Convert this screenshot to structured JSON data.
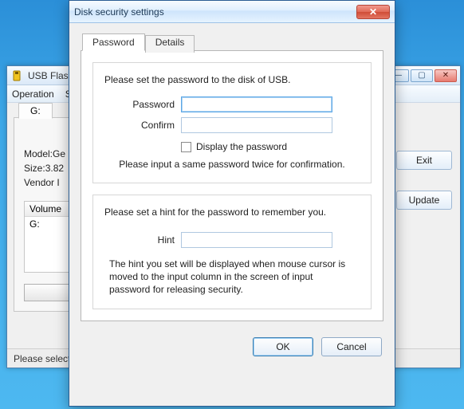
{
  "back_window": {
    "title": "USB Flash S",
    "menu": {
      "operation": "Operation",
      "second": "S"
    },
    "drive_tab": "G:",
    "info": {
      "model_label": "Model:",
      "model_value": "Ge",
      "size_label": "Size:",
      "size_value": "3.82",
      "vendor_label": "Vendor I"
    },
    "list": {
      "header": "Volume",
      "row": "G:"
    },
    "status": "Please select a ",
    "exit": "Exit",
    "update": "Update"
  },
  "dialog": {
    "title": "Disk security settings",
    "tabs": {
      "password": "Password",
      "details": "Details"
    },
    "pw_group": {
      "heading": "Please set the password to the disk of USB.",
      "password_label": "Password",
      "confirm_label": "Confirm",
      "display_checkbox": "Display the password",
      "note": "Please input a same password twice for confirmation.",
      "password_value": "",
      "confirm_value": ""
    },
    "hint_group": {
      "heading": "Please set a hint for the password to remember you.",
      "hint_label": "Hint",
      "hint_value": "",
      "note": "The hint you set will be displayed when mouse cursor is moved to the input column in the screen of input password for releasing security."
    },
    "buttons": {
      "ok": "OK",
      "cancel": "Cancel"
    }
  }
}
